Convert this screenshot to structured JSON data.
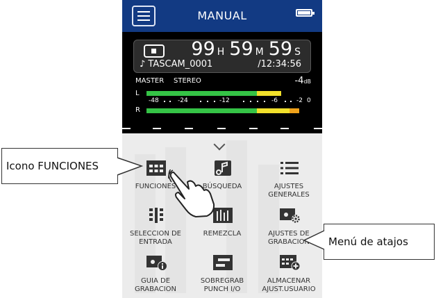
{
  "screen": {
    "title": "MANUAL",
    "counter": {
      "hours": "99",
      "h_unit": "H",
      "minutes": "59",
      "m_unit": "M",
      "seconds": "59",
      "s_unit": "S"
    },
    "file_name": "♪ TASCAM_0001",
    "remaining": "/12:34:56",
    "mix_label": "MASTER",
    "mode_label": "STEREO",
    "level_value": "-4",
    "level_unit": "dB",
    "channels": [
      "L",
      "R"
    ],
    "meter": {
      "left_level": 0.83,
      "right_level": 0.94
    },
    "scale_labels": [
      "-48",
      "-24",
      "-12",
      "-6",
      "-2",
      "0"
    ],
    "colors": {
      "titlebar": "#123a83",
      "meter_green": "#35c346",
      "meter_yellow": "#f1e02b",
      "meter_orange": "#f0a21b"
    },
    "menu": [
      {
        "label": "FUNCIONES",
        "icon": "grid-icon"
      },
      {
        "label": "BÚSQUEDA",
        "icon": "music-search-icon"
      },
      {
        "label": "AJUSTES GENERALES",
        "icon": "list-icon"
      },
      {
        "label": "SELECCION DE ENTRADA",
        "icon": "input-select-icon"
      },
      {
        "label": "REMEZCLA",
        "icon": "mixer-icon"
      },
      {
        "label": "AJUSTES DE GRABACION",
        "icon": "recorder-gear-icon"
      },
      {
        "label": "GUIA DE GRABACION",
        "icon": "recorder-info-icon"
      },
      {
        "label": "SOBREGRAB PUNCH I/O",
        "icon": "overdub-icon"
      },
      {
        "label": "ALMACENAR AJUST.USUARIO",
        "icon": "grid-add-icon"
      }
    ]
  },
  "callouts": {
    "functions_icon": "Icono FUNCIONES",
    "shortcut_menu": "Menú de atajos"
  }
}
